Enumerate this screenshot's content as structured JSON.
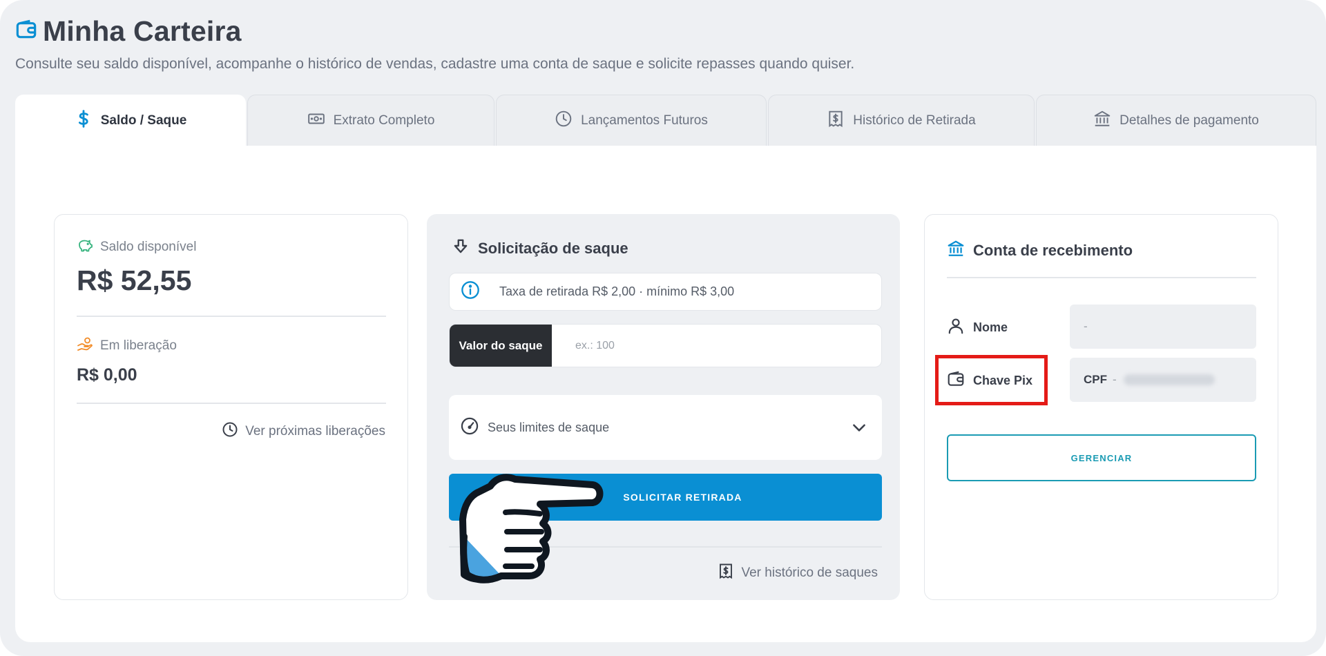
{
  "header": {
    "title": "Minha Carteira",
    "subtitle": "Consulte seu saldo disponível, acompanhe o histórico de vendas, cadastre uma conta de saque e solicite repasses quando quiser."
  },
  "tabs": [
    {
      "label": "Saldo / Saque",
      "icon": "dollar-icon",
      "active": true
    },
    {
      "label": "Extrato Completo",
      "icon": "cash-icon",
      "active": false
    },
    {
      "label": "Lançamentos Futuros",
      "icon": "clock-icon",
      "active": false
    },
    {
      "label": "Histórico de Retirada",
      "icon": "receipt-icon",
      "active": false
    },
    {
      "label": "Detalhes de pagamento",
      "icon": "bank-icon",
      "active": false
    }
  ],
  "balance": {
    "available_label": "Saldo disponível",
    "available_value": "R$ 52,55",
    "pending_label": "Em liberação",
    "pending_value": "R$ 0,00",
    "next_link": "Ver próximas liberações"
  },
  "withdraw": {
    "title": "Solicitação de saque",
    "fee_info": "Taxa de retirada R$ 2,00 · mínimo R$ 3,00",
    "amount_label": "Valor do saque",
    "amount_placeholder": "ex.: 100",
    "limits_label": "Seus limites de saque",
    "submit_label": "SOLICITAR RETIRADA",
    "history_link": "Ver histórico de saques"
  },
  "account": {
    "title": "Conta de recebimento",
    "name_label": "Nome",
    "name_value": "-",
    "pix_label": "Chave Pix",
    "pix_type": "CPF",
    "pix_separator": "-",
    "manage_label": "GERENCIAR"
  },
  "colors": {
    "accent": "#0a8fd3",
    "teal": "#1a9bb3",
    "highlight": "#e41b17",
    "dark": "#2b2e33"
  }
}
